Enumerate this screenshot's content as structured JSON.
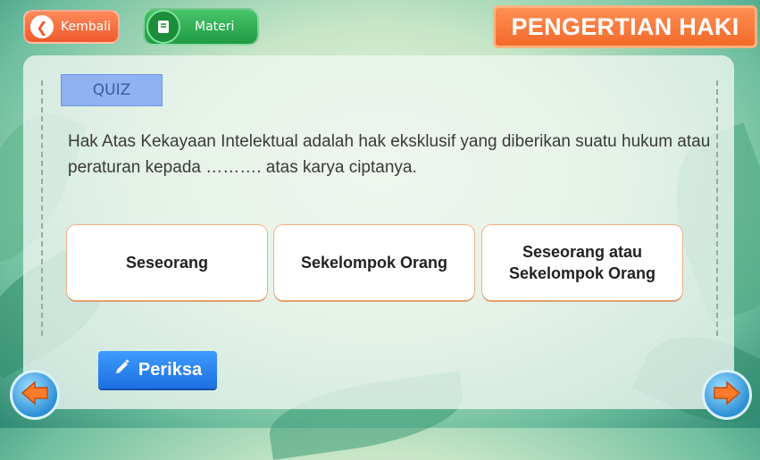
{
  "header": {
    "back_label": "Kembali",
    "materi_label": "Materi",
    "title": "PENGERTIAN HAKI"
  },
  "quiz": {
    "tab_label": "QUIZ",
    "question": "Hak Atas Kekayaan Intelektual adalah hak eksklusif yang diberikan suatu hukum atau peraturan kepada ………. atas karya ciptanya.",
    "options": [
      {
        "label": "Seseorang"
      },
      {
        "label": "Sekelompok Orang"
      },
      {
        "label": "Seseorang atau Sekelompok Orang"
      }
    ],
    "check_label": "Periksa"
  },
  "nav": {
    "prev_icon": "arrow-left-icon",
    "next_icon": "arrow-right-icon"
  },
  "colors": {
    "orange": "#f26a2a",
    "green": "#1f9c44",
    "blue": "#1c6fe0"
  }
}
